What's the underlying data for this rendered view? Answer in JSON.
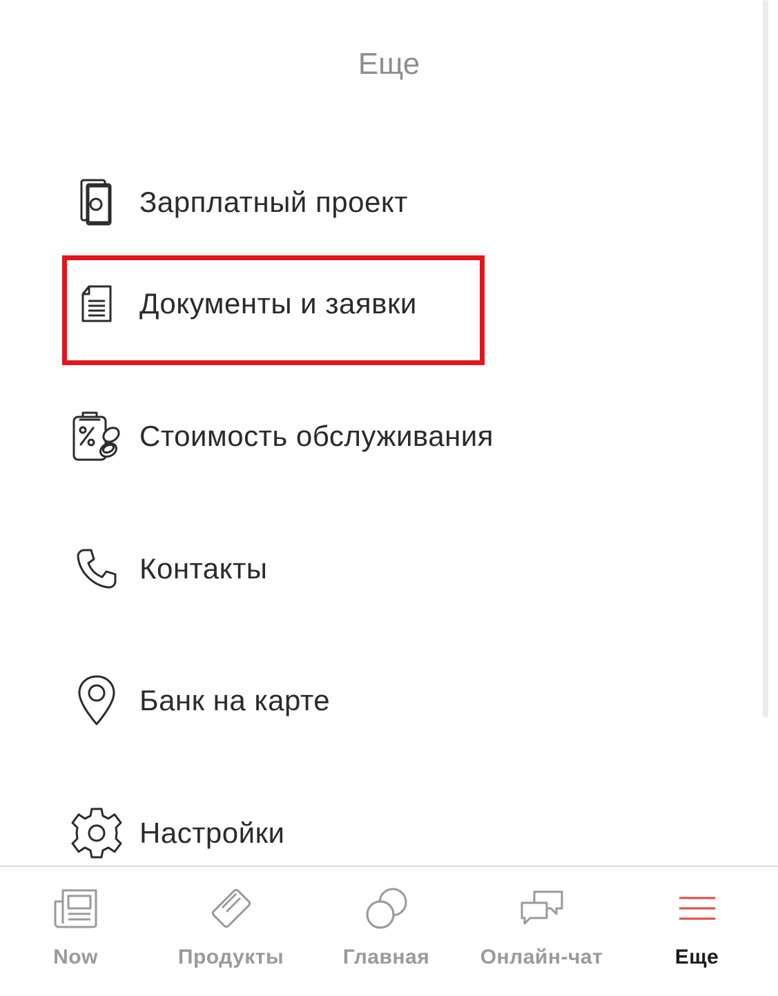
{
  "header": {
    "title": "Еще"
  },
  "menu": {
    "items": [
      {
        "label": "Зарплатный проект",
        "icon": "salary-card-icon"
      },
      {
        "label": "Документы и заявки",
        "icon": "document-icon"
      },
      {
        "label": "Стоимость обслуживания",
        "icon": "tariff-percent-icon"
      },
      {
        "label": "Контакты",
        "icon": "phone-icon"
      },
      {
        "label": "Банк на карте",
        "icon": "map-pin-icon"
      },
      {
        "label": "Настройки",
        "icon": "gear-icon"
      }
    ]
  },
  "highlight": {
    "color": "#e3151c",
    "target": "Документы и заявки"
  },
  "tabbar": {
    "tabs": [
      {
        "label": "Now",
        "icon": "newspaper-icon",
        "active": false
      },
      {
        "label": "Продукты",
        "icon": "card-icon",
        "active": false
      },
      {
        "label": "Главная",
        "icon": "circles-icon",
        "active": false
      },
      {
        "label": "Онлайн-чат",
        "icon": "chat-bubbles-icon",
        "active": false
      },
      {
        "label": "Еще",
        "icon": "menu-lines-icon",
        "active": true
      }
    ],
    "accent_color": "#e0493a"
  }
}
